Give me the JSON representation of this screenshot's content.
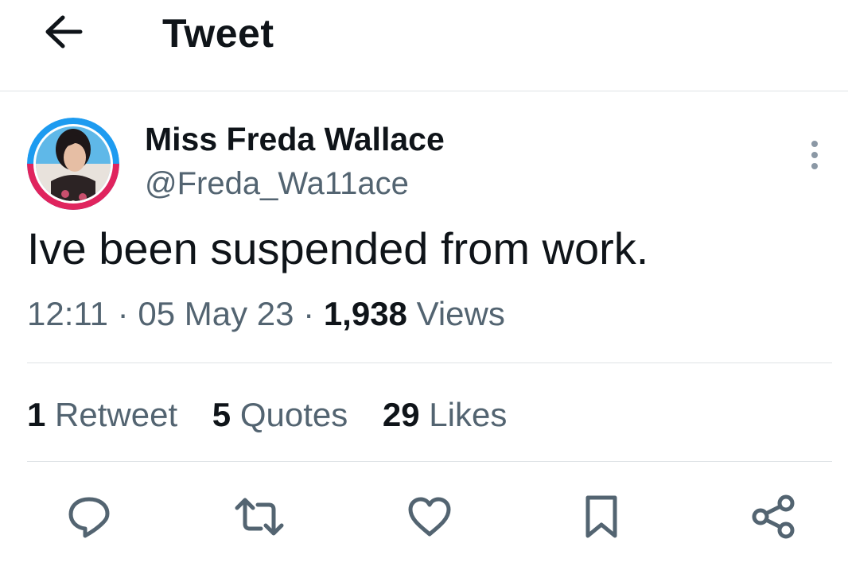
{
  "header": {
    "title": "Tweet",
    "back_icon": "arrow-left-icon"
  },
  "user": {
    "name": "Miss Freda Wallace",
    "handle": "@Freda_Wa11ace"
  },
  "tweet": {
    "text": "Ive been suspended from work.",
    "time": "12:11",
    "separator": "·",
    "date": "05 May 23",
    "views_count": "1,938",
    "views_label": "Views"
  },
  "stats": [
    {
      "count": "1",
      "label": "Retweet"
    },
    {
      "count": "5",
      "label": "Quotes"
    },
    {
      "count": "29",
      "label": "Likes"
    }
  ],
  "actions": [
    "reply-icon",
    "retweet-icon",
    "like-icon",
    "bookmark-icon",
    "share-icon"
  ],
  "colors": {
    "text": "#0f1419",
    "secondary": "#536471",
    "divider": "#dfe3e6",
    "avatar_ring_top": "#1d9bf0",
    "avatar_ring_bottom": "#e0245e"
  }
}
